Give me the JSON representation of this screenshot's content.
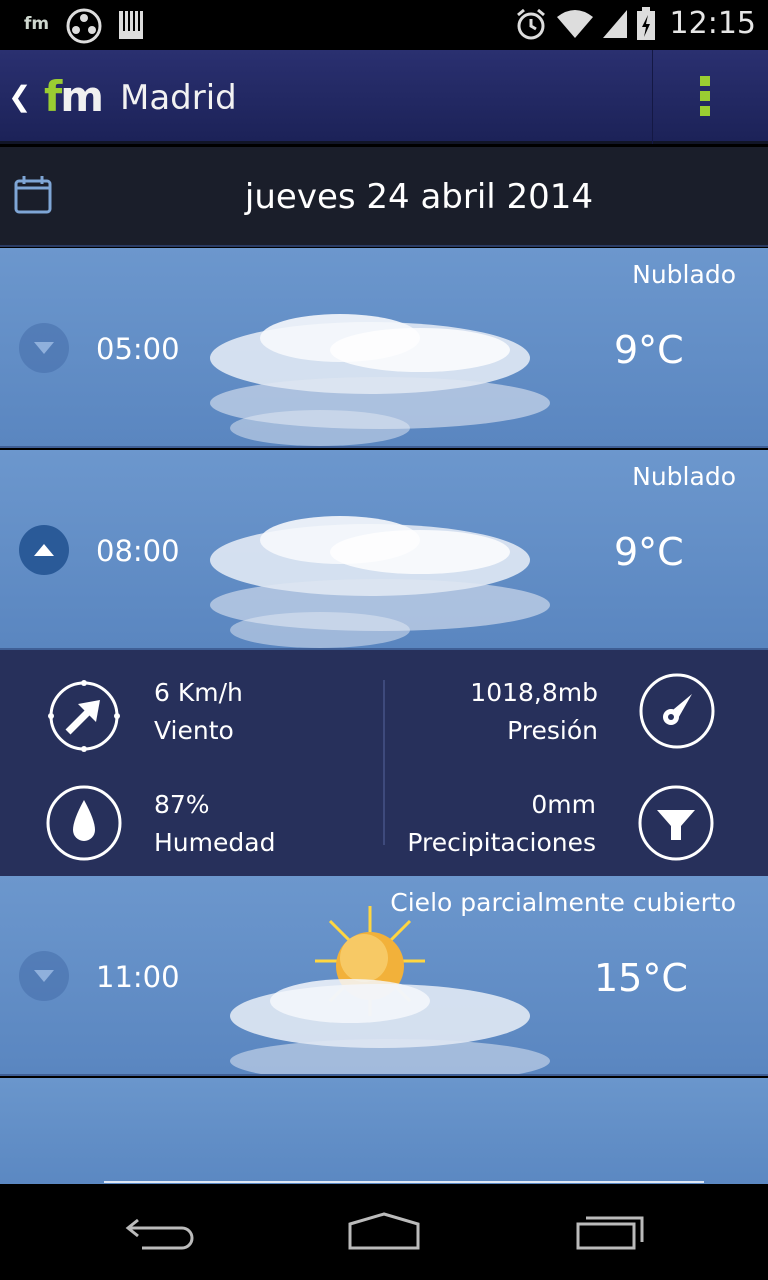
{
  "status_bar": {
    "app_notification_label": "fm",
    "time": "12:15"
  },
  "header": {
    "back_symbol": "❮",
    "logo_f": "f",
    "logo_m": "m",
    "city": "Madrid"
  },
  "date_bar": {
    "date": "jueves 24 abril 2014"
  },
  "hours": [
    {
      "time": "05:00",
      "condition": "Nublado",
      "temperature": "9°C",
      "icon": "cloudy-icon",
      "expanded": false
    },
    {
      "time": "08:00",
      "condition": "Nublado",
      "temperature": "9°C",
      "icon": "cloudy-icon",
      "expanded": true
    },
    {
      "time": "11:00",
      "condition": "Cielo parcialmente cubierto",
      "temperature": "15°C",
      "icon": "partly-cloudy-icon",
      "expanded": false
    }
  ],
  "details": {
    "wind_value": "6 Km/h",
    "wind_label": "Viento",
    "pressure_value": "1018,8mb",
    "pressure_label": "Presión",
    "humidity_value": "87%",
    "humidity_label": "Humedad",
    "precip_value": "0mm",
    "precip_label": "Precipitaciones"
  },
  "colors": {
    "accent": "#9acd32",
    "header_bg": "#222a66",
    "row_bg": "#6490c8",
    "detail_bg": "#27305b"
  }
}
